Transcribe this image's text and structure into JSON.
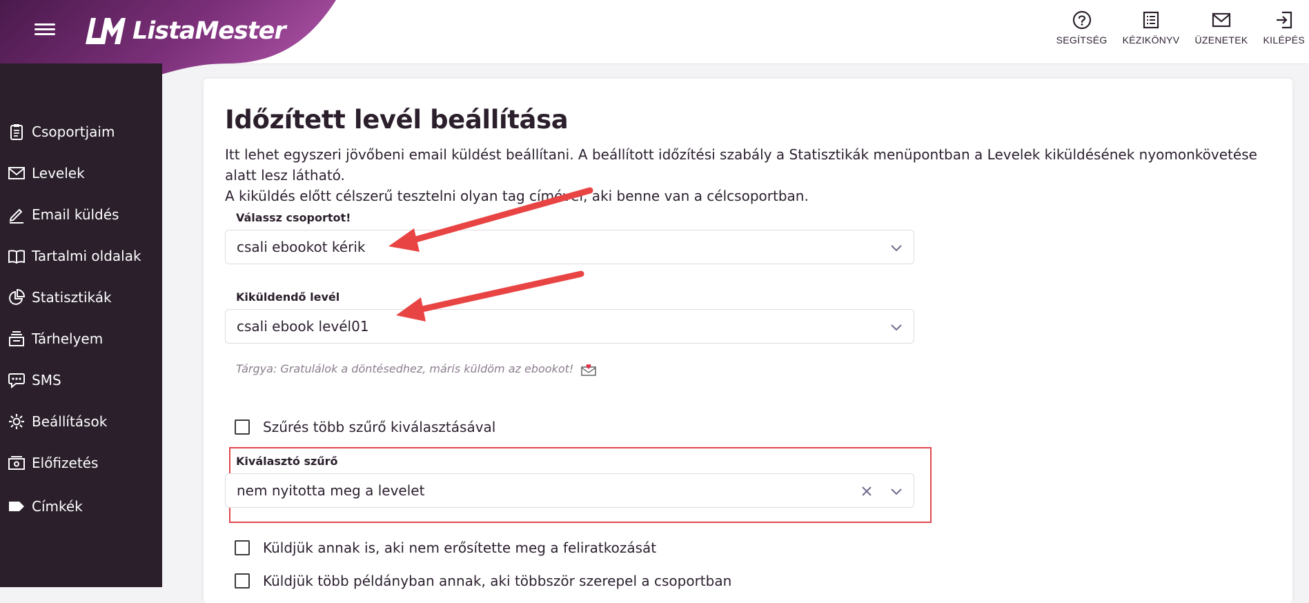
{
  "app": {
    "brand": "ListaMester"
  },
  "colors": {
    "sidebar_bg": "#2a1f2b",
    "brand_gradient_start": "#4a1a4c",
    "brand_gradient_end": "#a44d9e",
    "annotation_red": "#e0474c"
  },
  "header": {
    "actions": [
      {
        "label": "SEGÍTSÉG",
        "icon": "help-circle-icon"
      },
      {
        "label": "KÉZIKÖNYV",
        "icon": "manual-list-icon"
      },
      {
        "label": "ÜZENETEK",
        "icon": "mail-icon"
      },
      {
        "label": "KILÉPÉS",
        "icon": "logout-icon"
      }
    ]
  },
  "sidebar": {
    "items": [
      {
        "label": "Csoportjaim",
        "icon": "clipboard-icon"
      },
      {
        "label": "Levelek",
        "icon": "envelope-icon"
      },
      {
        "label": "Email küldés",
        "icon": "pencil-icon"
      },
      {
        "label": "Tartalmi oldalak",
        "icon": "book-icon"
      },
      {
        "label": "Statisztikák",
        "icon": "pie-chart-icon"
      },
      {
        "label": "Tárhelyem",
        "icon": "storage-icon"
      },
      {
        "label": "SMS",
        "icon": "chat-bubble-icon"
      },
      {
        "label": "Beállítások",
        "icon": "gear-icon"
      },
      {
        "label": "Előfizetés",
        "icon": "ticket-icon"
      },
      {
        "label": "Címkék",
        "icon": "tag-icon"
      }
    ]
  },
  "main": {
    "title": "Időzített levél beállítása",
    "description_line1": "Itt lehet egyszeri jövőbeni email küldést beállítani. A beállított időzítési szabály a Statisztikák menüpontban a Levelek kiküldésének nyomonkövetése alatt lesz látható.",
    "description_line2": "A kiküldés előtt célszerű tesztelni olyan tag címével, aki benne van a célcsoportban.",
    "group_label": "Válassz csoportot!",
    "group_value": "csali ebookot kérik",
    "letter_label": "Kiküldendő levél",
    "letter_value": "csali ebook levél01",
    "subject": "Tárgya: Gratulálok a döntésedhez, máris küldöm az ebookot!",
    "multi_filter_label": "Szűrés több szűrő kiválasztásával",
    "filter_label": "Kiválasztó szűrő",
    "filter_value": "nem nyitotta meg a levelet",
    "send_unconfirmed_label": "Küldjük annak is, aki nem erősítette meg a feliratkozását",
    "send_multiple_label": "Küldjük több példányban annak, aki többször szerepel a csoportban"
  }
}
